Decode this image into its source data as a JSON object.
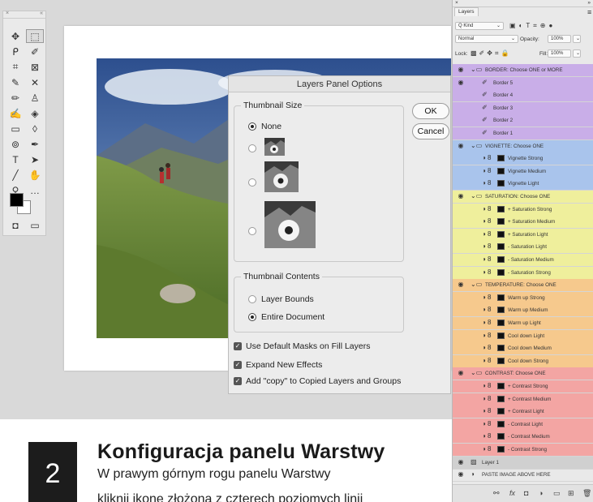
{
  "toolbox": {
    "close_glyph": "×",
    "collapse_glyph": "«",
    "tools": [
      {
        "icon": "move-tool-icon",
        "glyph": "✥"
      },
      {
        "icon": "marquee-tool-icon",
        "glyph": "⬚"
      },
      {
        "icon": "lasso-tool-icon",
        "glyph": "ᑭ"
      },
      {
        "icon": "quick-select-tool-icon",
        "glyph": "✐"
      },
      {
        "icon": "crop-tool-icon",
        "glyph": "⌗"
      },
      {
        "icon": "frame-tool-icon",
        "glyph": "⊠"
      },
      {
        "icon": "eyedropper-tool-icon",
        "glyph": "✎"
      },
      {
        "icon": "healing-tool-icon",
        "glyph": "✕"
      },
      {
        "icon": "brush-tool-icon",
        "glyph": "✏"
      },
      {
        "icon": "stamp-tool-icon",
        "glyph": "♙"
      },
      {
        "icon": "history-brush-icon",
        "glyph": "✍"
      },
      {
        "icon": "eraser-tool-icon",
        "glyph": "◈"
      },
      {
        "icon": "gradient-tool-icon",
        "glyph": "▭"
      },
      {
        "icon": "blur-tool-icon",
        "glyph": "◊"
      },
      {
        "icon": "dodge-tool-icon",
        "glyph": "⊚"
      },
      {
        "icon": "pen-tool-icon",
        "glyph": "✒"
      },
      {
        "icon": "type-tool-icon",
        "glyph": "T"
      },
      {
        "icon": "path-select-tool-icon",
        "glyph": "➤"
      },
      {
        "icon": "line-tool-icon",
        "glyph": "╱"
      },
      {
        "icon": "hand-tool-icon",
        "glyph": "✋"
      },
      {
        "icon": "zoom-tool-icon",
        "glyph": "⚲"
      },
      {
        "icon": "more-tools-icon",
        "glyph": "…"
      },
      {
        "icon": "quick-mask-icon",
        "glyph": "◘"
      },
      {
        "icon": "screen-mode-icon",
        "glyph": "▭"
      }
    ]
  },
  "dialog": {
    "title": "Layers Panel Options",
    "thumbnail_size_label": "Thumbnail Size",
    "none_label": "None",
    "ok_label": "OK",
    "cancel_label": "Cancel",
    "thumbnail_contents_label": "Thumbnail Contents",
    "layer_bounds_label": "Layer Bounds",
    "entire_document_label": "Entire Document",
    "check1": "Use Default Masks on Fill Layers",
    "check2": "Expand New Effects",
    "check3": "Add \"copy\" to Copied Layers and Groups"
  },
  "layers_panel": {
    "close_glyph": "×",
    "collapse_glyph": "»",
    "tab_label": "Layers",
    "kind_label": "Q Kind",
    "blend_mode": "Normal",
    "opacity_label": "Opacity:",
    "opacity_value": "100%",
    "lock_label": "Lock:",
    "fill_label": "Fill:",
    "fill_value": "100%",
    "colors": {
      "purple": "#c9aee8",
      "blue": "#a9c4ec",
      "yellow": "#efef9c",
      "orange": "#f6c98d",
      "red": "#f3a5a3",
      "gray": "#d6d6d6"
    },
    "rows": [
      {
        "name": "BORDER: Choose ONE or MORE",
        "kind": "group",
        "color": "purple",
        "eye": true
      },
      {
        "name": "Border 5",
        "kind": "brush",
        "color": "purple",
        "eye": true
      },
      {
        "name": "Border 4",
        "kind": "brush",
        "color": "purple",
        "eye": false
      },
      {
        "name": "Border 3",
        "kind": "brush",
        "color": "purple",
        "eye": false
      },
      {
        "name": "Border 2",
        "kind": "brush",
        "color": "purple",
        "eye": false
      },
      {
        "name": "Border 1",
        "kind": "brush",
        "color": "purple",
        "eye": false
      },
      {
        "name": "VIGNETTE: Choose ONE",
        "kind": "group",
        "color": "blue",
        "eye": true
      },
      {
        "name": "Vignette Strong",
        "kind": "adj",
        "color": "blue",
        "eye": false
      },
      {
        "name": "Vignette Medium",
        "kind": "adj",
        "color": "blue",
        "eye": false
      },
      {
        "name": "Vignette Light",
        "kind": "adj",
        "color": "blue",
        "eye": false
      },
      {
        "name": "SATURATION: Choose ONE",
        "kind": "group",
        "color": "yellow",
        "eye": true
      },
      {
        "name": "+ Saturation Strong",
        "kind": "adj",
        "color": "yellow",
        "eye": false
      },
      {
        "name": "+ Saturation Medium",
        "kind": "adj",
        "color": "yellow",
        "eye": false
      },
      {
        "name": "+ Saturation Light",
        "kind": "adj",
        "color": "yellow",
        "eye": false
      },
      {
        "name": "- Saturation Light",
        "kind": "adj",
        "color": "yellow",
        "eye": false
      },
      {
        "name": "- Saturation Medium",
        "kind": "adj",
        "color": "yellow",
        "eye": false
      },
      {
        "name": "- Saturation Strong",
        "kind": "adj",
        "color": "yellow",
        "eye": false
      },
      {
        "name": "TEMPERATURE: Choose ONE",
        "kind": "group",
        "color": "orange",
        "eye": true
      },
      {
        "name": "Warm up Strong",
        "kind": "adj",
        "color": "orange",
        "eye": false
      },
      {
        "name": "Warm up Medium",
        "kind": "adj",
        "color": "orange",
        "eye": false
      },
      {
        "name": "Warm up Light",
        "kind": "adj",
        "color": "orange",
        "eye": false
      },
      {
        "name": "Cool down Light",
        "kind": "adj",
        "color": "orange",
        "eye": false
      },
      {
        "name": "Cool down Medium",
        "kind": "adj",
        "color": "orange",
        "eye": false
      },
      {
        "name": "Cool down Strong",
        "kind": "adj",
        "color": "orange",
        "eye": false
      },
      {
        "name": "CONTRAST: Choose ONE",
        "kind": "group",
        "color": "red",
        "eye": true
      },
      {
        "name": "+ Contrast Strong",
        "kind": "adj",
        "color": "red",
        "eye": false
      },
      {
        "name": "+ Contrast Medium",
        "kind": "adj",
        "color": "red",
        "eye": false
      },
      {
        "name": "+ Contrast Light",
        "kind": "adj",
        "color": "red",
        "eye": false
      },
      {
        "name": "- Contrast Light",
        "kind": "adj",
        "color": "red",
        "eye": false
      },
      {
        "name": "- Contrast Medium",
        "kind": "adj",
        "color": "red",
        "eye": false
      },
      {
        "name": "- Contrast Strong",
        "kind": "adj",
        "color": "red",
        "eye": false
      },
      {
        "name": "Layer 1",
        "kind": "layer",
        "color": "gray",
        "eye": true
      },
      {
        "name": "PASTE IMAGE ABOVE HERE",
        "kind": "fill",
        "color": "none",
        "eye": true
      }
    ],
    "footer_icons": [
      "link-icon",
      "fx-icon",
      "mask-icon",
      "adjustment-icon",
      "folder-icon",
      "new-layer-icon",
      "trash-icon"
    ]
  },
  "caption": {
    "number": "2",
    "title": "Konfiguracja panelu Warstwy",
    "line1": "W prawym górnym rogu panelu Warstwy",
    "line2": "kliknij ikonę złożoną z czterech poziomych linii"
  }
}
